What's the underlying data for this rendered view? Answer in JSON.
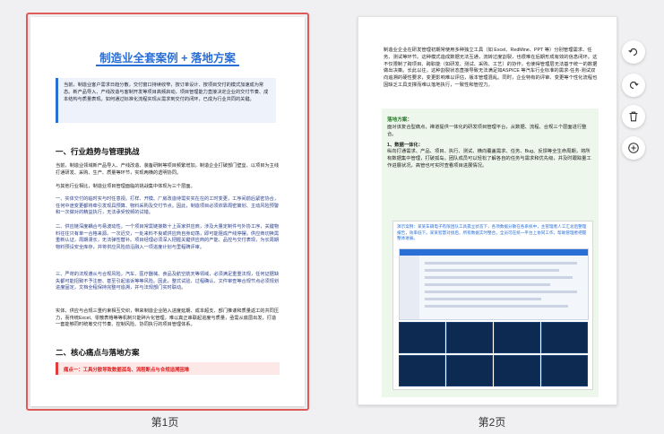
{
  "pages": [
    {
      "label": "第1页",
      "selected": true,
      "title": "制造业全套案例 + 落地方案",
      "intro": "当前，制造业客户需求日趋分散，交付窗口持续收窄，按订单设计、按项目交付的模式加速成为常态。新产品导入、产线改造与客制开发等项目高频启动，项目管理能力直接决定企业的交付节奏、成本结构与质量表现。如何通过标准化流程实现从需求到交付的闭环，已成为行业共同的关键。",
      "h1": "一、行业趋势与管理挑战",
      "para1": "当前，制造业领域新产品导入、产线改造、装备研制等项目频繁增加，制造企业打破部门壁垒、以项目为主线打通研发、采购、生产、质量等环节，实现两横的透明协同。",
      "para2": "与其他行业相比，制造业项目管理面临的挑战集中体现为三个层面。",
      "para3": "一、实体交付的临时实与时任意视。打样、开模、厂房改造待需实实在在的工时变更，工序间前后紧密协合，任何中途变更都将牵引发现具预算、物料采购及交付节点。因此，制造项目必须依靠周密策划、主动风险预警和一次做对的精益执行，无法承受较频的试错。",
      "para4": "二、供应链深度耦合与易波动性。一个项目常需链接数十上百家供应商，涉及大量定制件与外协工序，关键物料往往只有单一合格来源。一次迟交，一处来料不良或供应商自身动荡，即可能阻成产线停摆。供应商切换需重新认证，周期漫长，无法弹性替补。项目经理必须深入把握关键供应商的产能、品控与交付表现，为长周期物料预设安全库存，并将供应风险前沿融入一项进度计划与里程碑评审。",
      "para5": "三、严苛的法规遵从与合规风险。汽车、医疗器械、食品及航空航天等领域，必须满足重重法规，任何证据缺失都可能招致不予注册、甚至引起追诉等等风险。因此，整式试验、过程确认、文件审查等合规节点必须规划进度固定，文档全程保持完整可追溯，并与法规部门实时联动。",
      "para6": "实体、供应与合规三重约束相互交织，带来制造企业陷入进度延期、成本超支、部门推诿和质量返工的共同压力，而传统Excel、零散表格等等机制只能碎片化管理，难以真正串联起进度与质量，亟需从底层出发，打造一套能够同时统筹交付节奏、控制风险、协同执行的项目管理体系。",
      "h2": "二、核心痛点与落地方案",
      "pain": "痛点一：工具分散导致数据孤岛、流程断点与合规追溯困难"
    },
    {
      "label": "第2页",
      "selected": false,
      "top_text": "制造业企业在研发管理初期常使用多种独立工具（如 Excel、RedMine、PPT 等）分别管理需求、任务、测试等环节。这种模式造成数据无法互通，流转过度割裂，也很难在后期形成有效的信息闭环。这不仅限制了跨项目、跨职能（如研发、测试、采购、工艺）的协作，也使得管理层无法基于统一的数据做出决策。长此以往，这种割裂状态直接导致无法满足如ASPICE 等汽车行业标准的需求-任务-测试双向追溯的硬性要求，变更影响难以评估，版本管理混乱。同时，企业特有的评审、变更等个性化流程也因缺乏工具支撑而难以落地执行，一致性和管控力。",
      "green_head": "落地方案：",
      "green_text": "面对该复合型痛点，禅道提供一体化的研发项目管理平台，从数据、流程、合规三个层面进行整合。",
      "green_sub": "1、数据一体化：",
      "green_sub_text": "纵向打通需求、产品、项目、执行、测试、横向覆盖需求、任务、Bug、反馈等全生命周期，将所有数据集中管理，打破孤岛。团队成员可以轻松了解各自的任务与需求和优先级，并及时跟踪量工作进展状况，高管也可实时查看项目进展情况。",
      "case_text": "演示案例：某某车辆电子有限团队工具孤立状态下，各项数据分散在各系统中，主管理者人工汇总后整理报告，效率低下。某某智慧对接后，所有数据实时整合，全员可在统一平台上协同工作，帮助管理者把握整体进展。"
    }
  ],
  "tools": [
    {
      "name": "rotate-left",
      "icon": "rotate-left-icon"
    },
    {
      "name": "rotate-right",
      "icon": "rotate-right-icon"
    },
    {
      "name": "delete",
      "icon": "trash-icon"
    },
    {
      "name": "add",
      "icon": "plus-circle-icon"
    }
  ],
  "colors": {
    "accent": "#2a6fd6",
    "selected_border": "#e05a5a",
    "danger": "#e02020",
    "green_bg": "#eef7ec"
  }
}
